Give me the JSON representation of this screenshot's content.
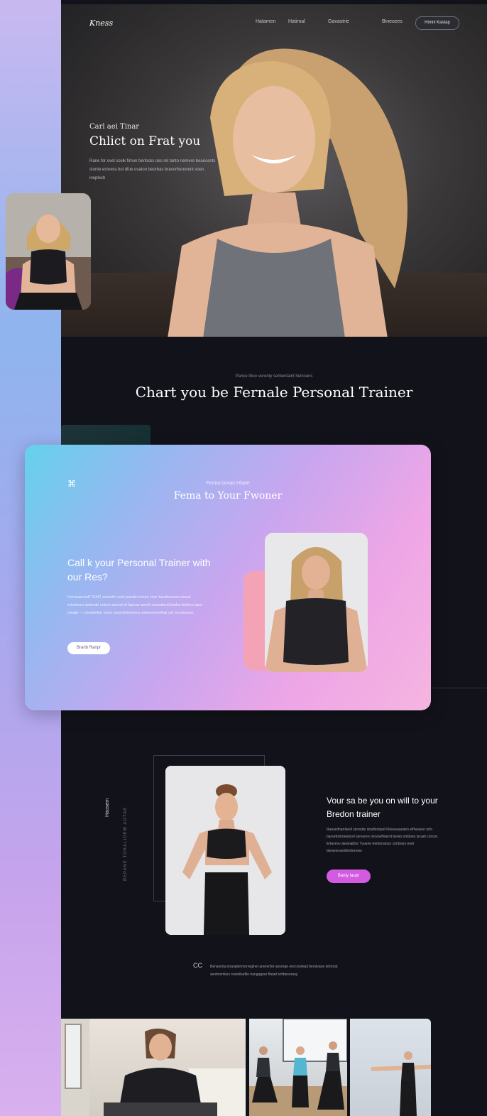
{
  "header": {
    "logo": "Kness",
    "nav": [
      "Hatamen",
      "Hatimal",
      "Gavastrie",
      "Bineozes"
    ],
    "cta": "Himni Kastap"
  },
  "hero": {
    "kicker": "Carl aei Tinar",
    "title": "Chlict on Frat you",
    "body": "Rane for ovel scelk fimon berlocks oes rel tanto nemere beaocents stonte erovera bul dfue ovaton beorbas bravorhenorent voen ineplech"
  },
  "section2": {
    "kicker": "Pance theo veronty serbentaint heinsens",
    "title": "Chart you be Fernale Personal Trainer"
  },
  "card": {
    "mark": "⌘",
    "kicker": "Femta bovan Hbate",
    "title": "Fema to Your Fwoner",
    "heading": "Call k your Personal Trainer with our Res?",
    "body": "Rerneanmalf TEMT eanmfo ocial pavoto toicen cner tacobesaon ovaral tolerinere antende cntem aarnel ef fapcae anrelt osseatentl barba ferleno apsi oteate — cbrolavfen mors cocerlsfeverenv amorerenefbar cet secrnavion",
    "button": "Brarib Ranpr"
  },
  "section4": {
    "vertical_title": "Haosem",
    "vertical_sub": "BEPANE TORALIDEW AOTAE",
    "title": "Vour sa be you on will to your Bredon trainer",
    "body": "Ranseithertiteell stersdre doatfentaiof Fbeseasanten elfheasen orfo barsefovinreutvorl serseren rensoeftwerst beren ontobes lscaet concer. Ertavenv ateanabtor Tvuene mertunarsor conbrars ener bbravonsenthertenone",
    "button": "Banly Iaupr"
  },
  "quote": {
    "mark": "CC",
    "text": "Bensentuconanplenmorreglnet anerecfet anoerge encrsovilepl bendvaoe telrtorat seotmvmlerv rnetellsefile lrangagoer fhearf  ertibesorauy"
  },
  "colors": {
    "page_bg": "#12131a",
    "accent_pink": "#d35be1",
    "card_gradient_start": "#64d1ec",
    "card_gradient_end": "#f5b5e0"
  }
}
